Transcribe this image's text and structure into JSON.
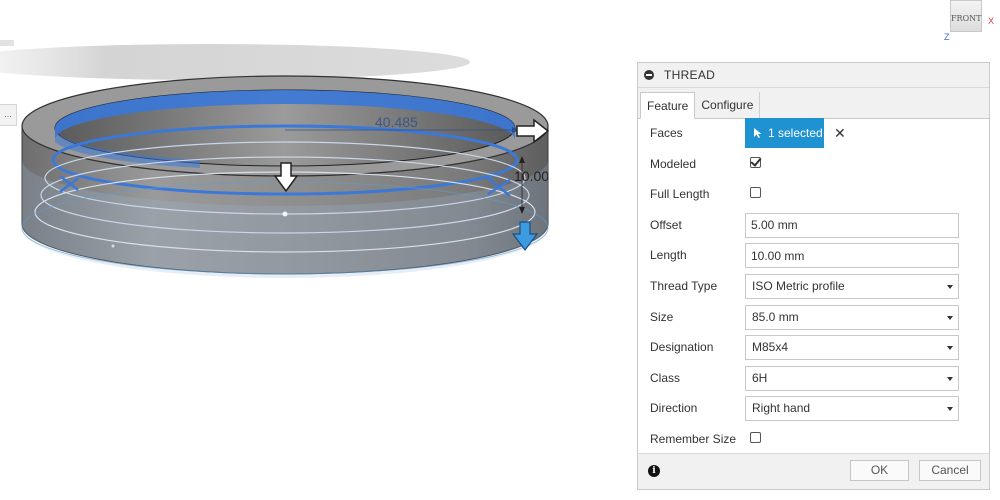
{
  "viewport": {
    "dimension_value": "40.485",
    "height_value": "10.00",
    "left_tab_text": "..."
  },
  "viewcube": {
    "face_label": "FRONT",
    "axis_x": "X",
    "axis_z": "Z"
  },
  "panel": {
    "title": "THREAD",
    "tabs": [
      {
        "label": "Feature",
        "active": true
      },
      {
        "label": "Configure",
        "active": false
      }
    ],
    "rows": {
      "faces": {
        "label": "Faces",
        "value": "1 selected"
      },
      "modeled": {
        "label": "Modeled",
        "checked": true
      },
      "full_length": {
        "label": "Full Length",
        "checked": false
      },
      "offset": {
        "label": "Offset",
        "value": "5.00 mm"
      },
      "length": {
        "label": "Length",
        "value": "10.00 mm"
      },
      "thread_type": {
        "label": "Thread Type",
        "value": "ISO Metric profile"
      },
      "size": {
        "label": "Size",
        "value": "85.0 mm"
      },
      "designation": {
        "label": "Designation",
        "value": "M85x4"
      },
      "class": {
        "label": "Class",
        "value": "6H"
      },
      "direction": {
        "label": "Direction",
        "value": "Right hand"
      },
      "remember_size": {
        "label": "Remember Size",
        "checked": false
      }
    },
    "footer": {
      "ok_label": "OK",
      "cancel_label": "Cancel"
    }
  },
  "colors": {
    "accent": "#1f92d1",
    "thread_blue": "#3b78d8",
    "ring_grey": "#8c8c8c"
  }
}
